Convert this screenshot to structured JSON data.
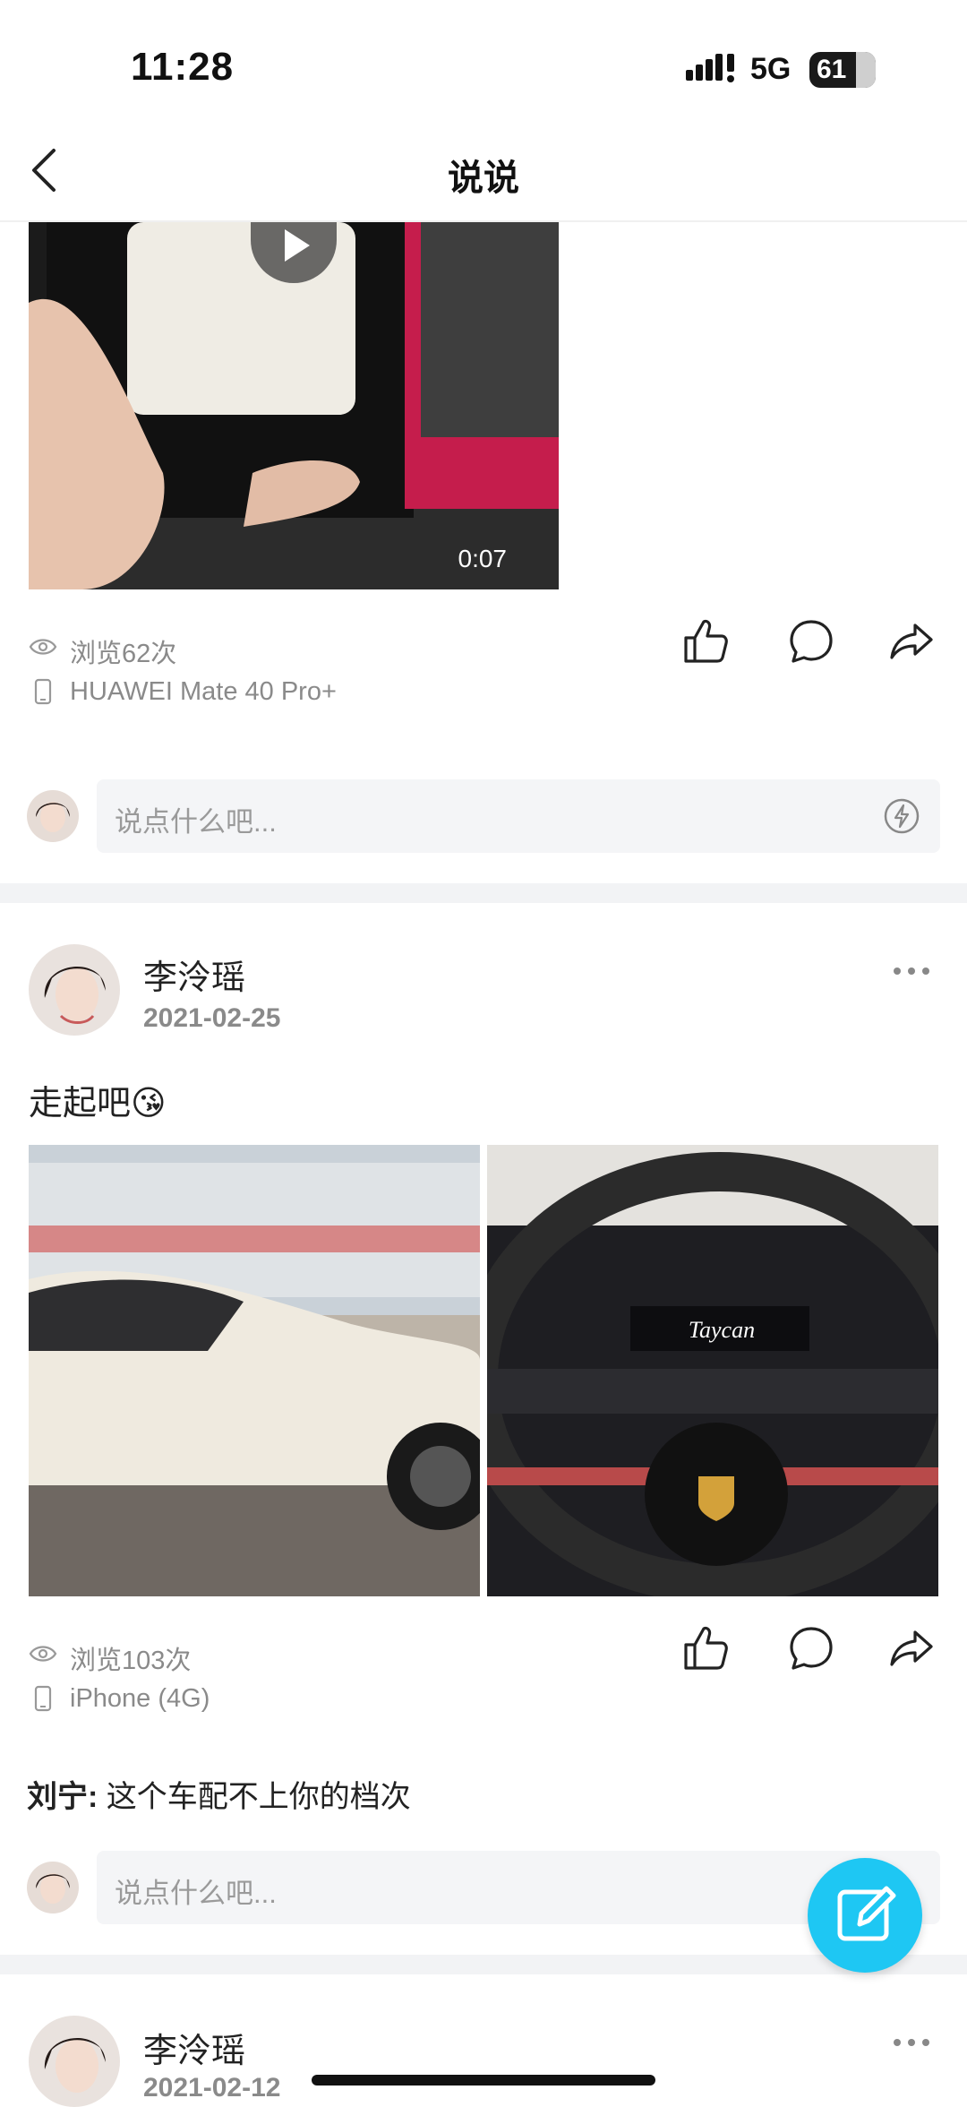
{
  "status_bar": {
    "time": "11:28",
    "network": "5G",
    "battery": "61"
  },
  "nav": {
    "title": "说说"
  },
  "post1": {
    "video_duration": "0:07",
    "views": "浏览62次",
    "device": "HUAWEI Mate 40 Pro+",
    "comment_placeholder": "说点什么吧..."
  },
  "post2": {
    "author": "李泠瑶",
    "date": "2021-02-25",
    "text": "走起吧😘",
    "views": "浏览103次",
    "device": "iPhone (4G)",
    "comment": {
      "author": "刘宁:",
      "text": "这个车配不上你的档次"
    },
    "comment_placeholder": "说点什么吧..."
  },
  "post3": {
    "author": "李泠瑶",
    "date": "2021-02-12"
  },
  "colors": {
    "fab": "#1ec7f3",
    "separator": "#f2f3f5",
    "input_bg": "#f4f5f7"
  },
  "icons": [
    "back-icon",
    "play-icon",
    "eye-icon",
    "phone-icon",
    "like-icon",
    "comment-icon",
    "share-icon",
    "flash-emoji-icon",
    "more-icon",
    "edit-icon"
  ]
}
